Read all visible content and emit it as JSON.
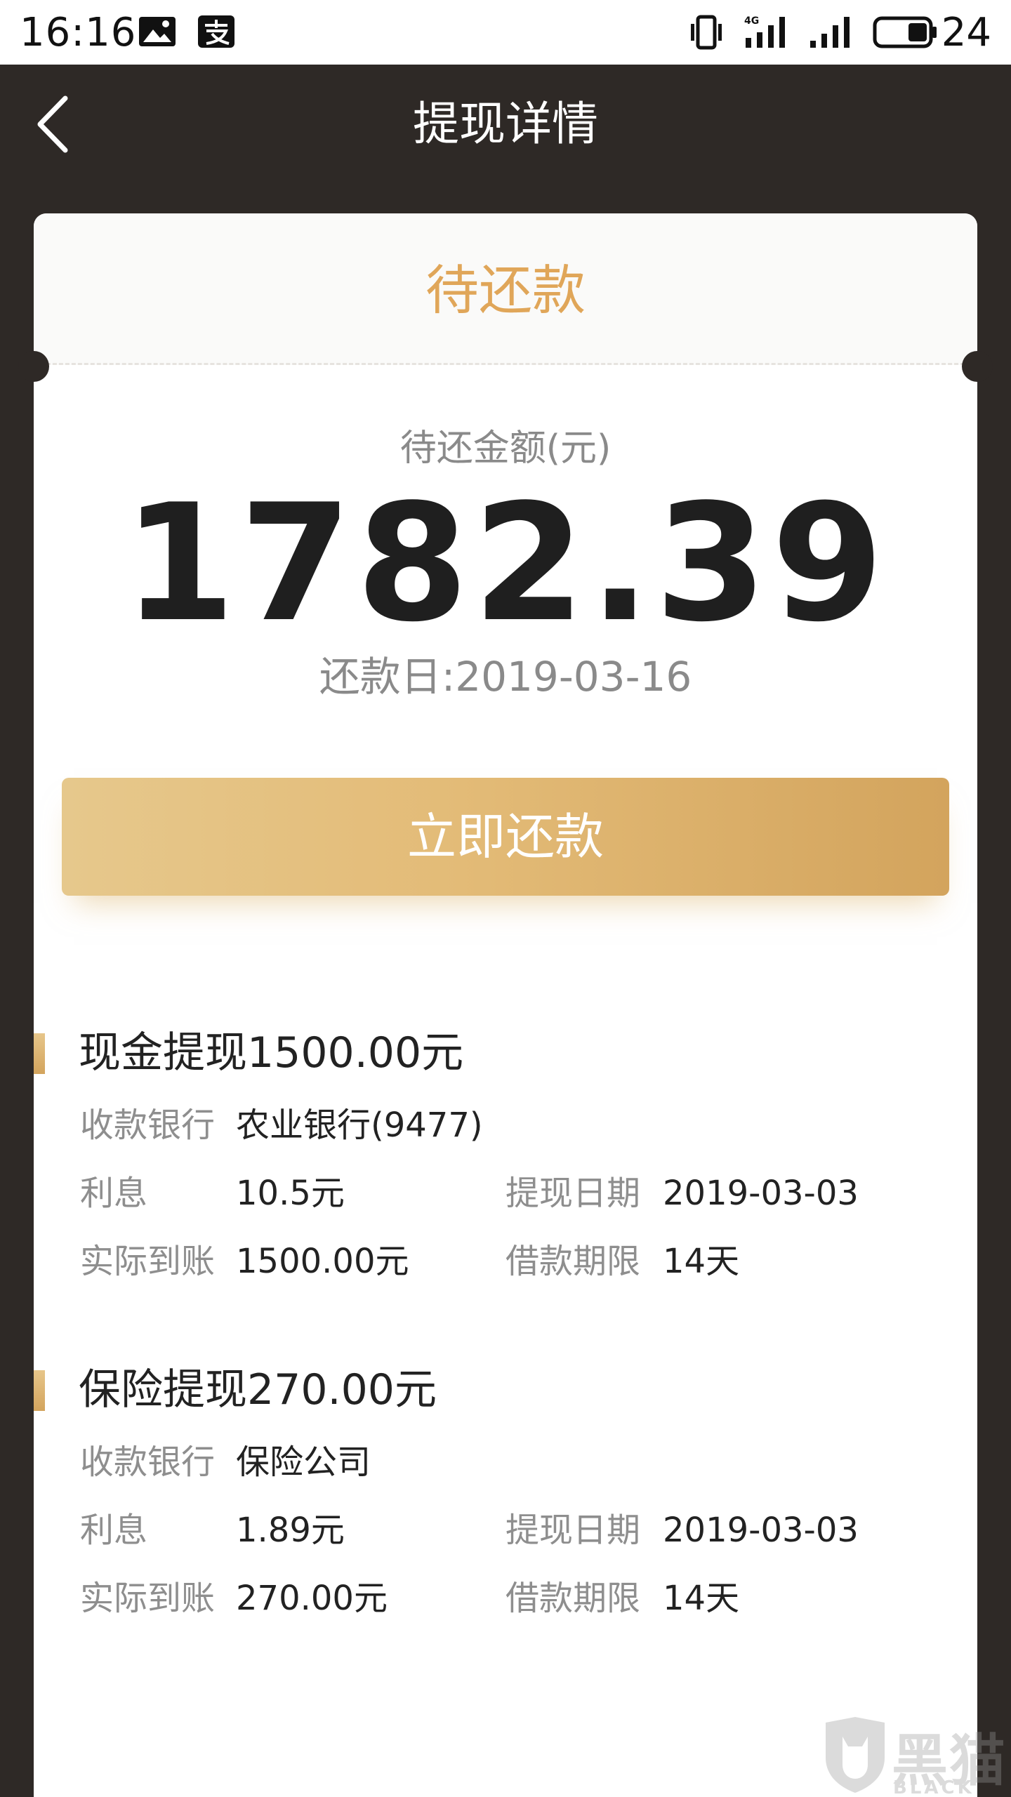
{
  "status_bar": {
    "time": "16:16",
    "network": "4G",
    "battery": "24",
    "icons": [
      "gallery-icon",
      "alipay-icon",
      "vibrate-icon",
      "signal-4g-icon",
      "signal-icon",
      "battery-icon"
    ]
  },
  "header": {
    "title": "提现详情",
    "back_icon": "chevron-left-icon"
  },
  "summary": {
    "status": "待还款",
    "amount_label": "待还金额(元)",
    "amount": "1782.39",
    "due_date": "还款日:2019-03-16",
    "repay_button": "立即还款"
  },
  "sections": [
    {
      "title": "现金提现1500.00元",
      "bank_label": "收款银行",
      "bank_value": "农业银行(9477)",
      "interest_label": "利息",
      "interest_value": "10.5元",
      "date_label": "提现日期",
      "date_value": "2019-03-03",
      "received_label": "实际到账",
      "received_value": "1500.00元",
      "term_label": "借款期限",
      "term_value": "14天"
    },
    {
      "title": "保险提现270.00元",
      "bank_label": "收款银行",
      "bank_value": "保险公司",
      "interest_label": "利息",
      "interest_value": "1.89元",
      "date_label": "提现日期",
      "date_value": "2019-03-03",
      "received_label": "实际到账",
      "received_value": "270.00元",
      "term_label": "借款期限",
      "term_value": "14天"
    }
  ],
  "watermark": {
    "text": "黑猫",
    "sub": "BLACK CAT"
  },
  "colors": {
    "header_bg": "#2e2926",
    "accent": "#e0a659",
    "button_start": "#e6c88c",
    "button_end": "#d3a45d"
  }
}
